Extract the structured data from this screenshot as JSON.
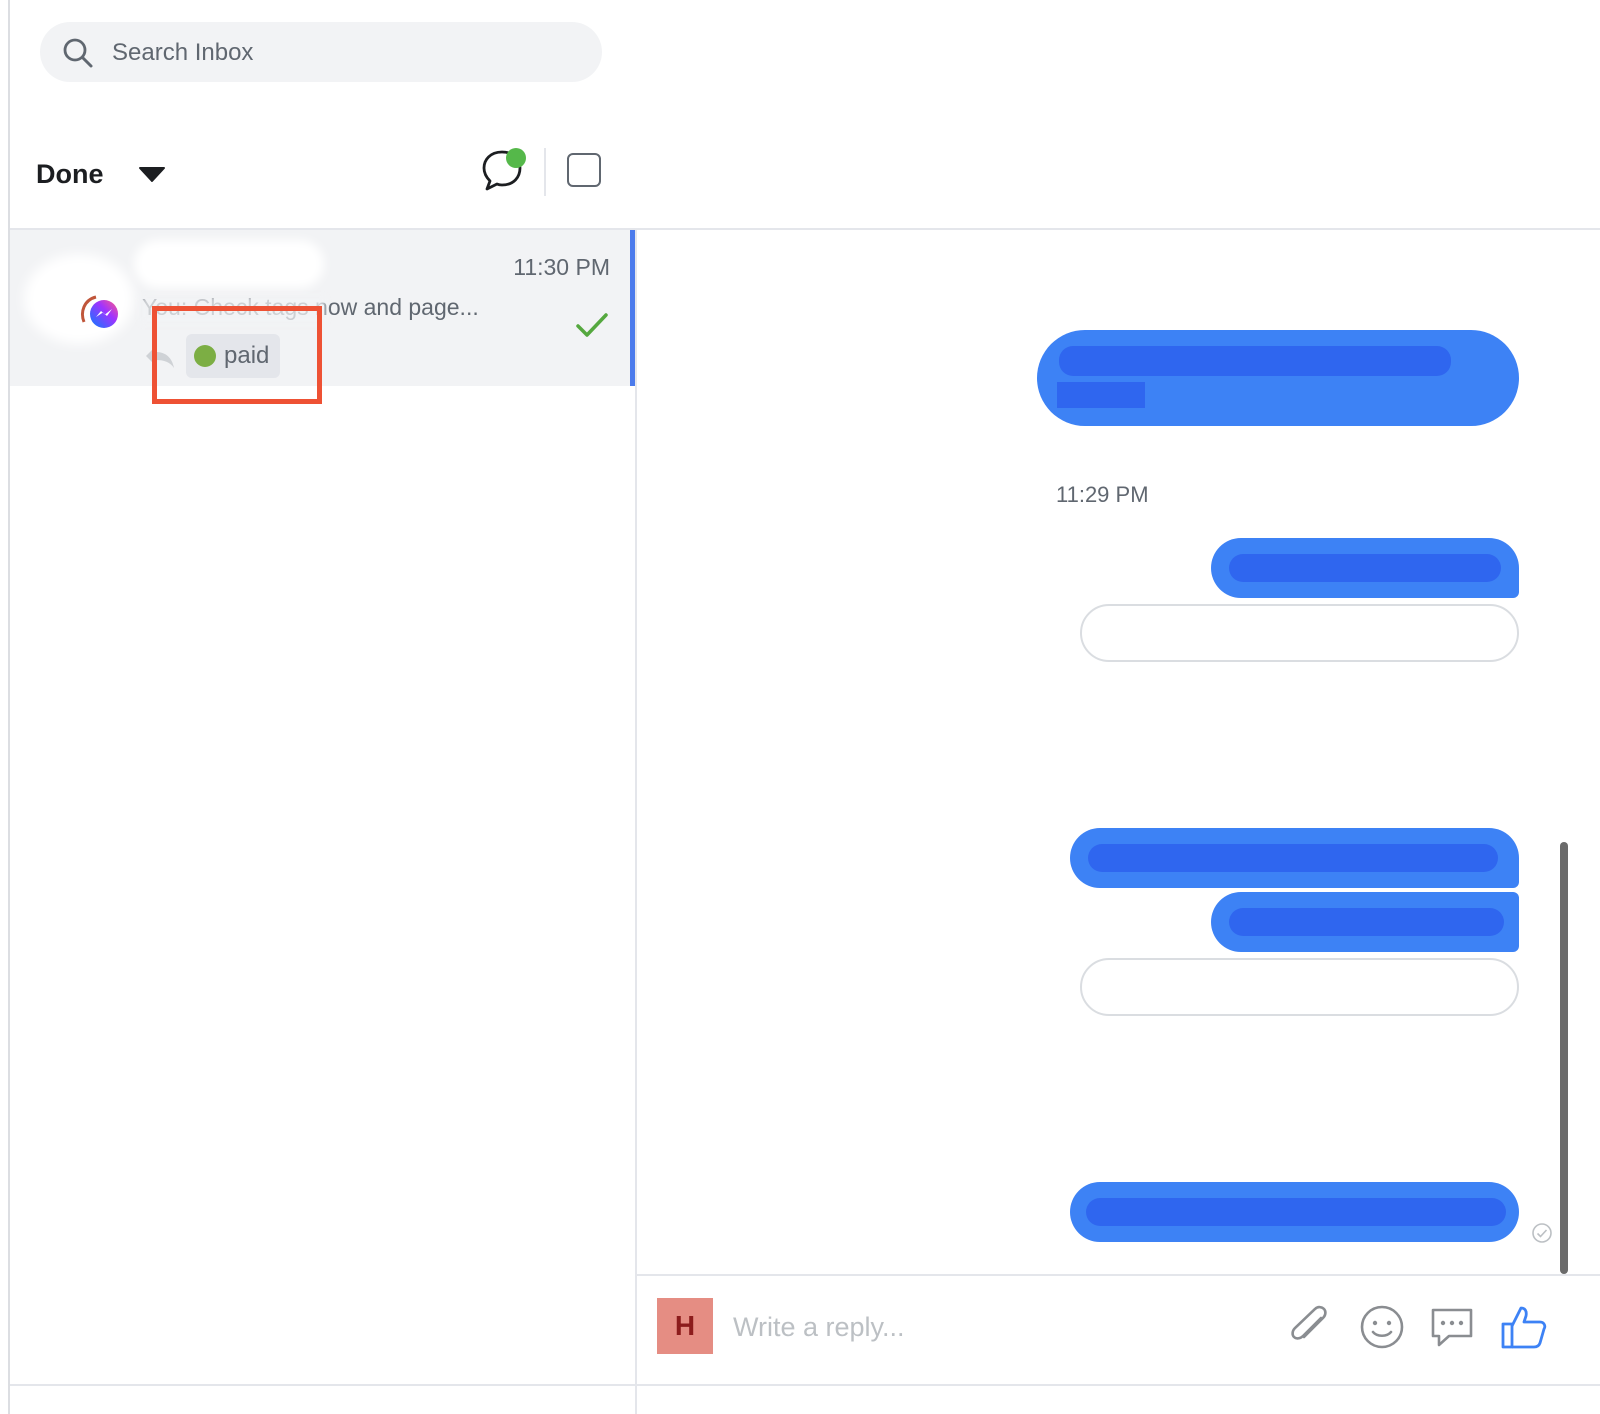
{
  "search": {
    "placeholder": "Search Inbox"
  },
  "toolbar": {
    "status_label": "Done"
  },
  "conversations": [
    {
      "time": "11:30 PM",
      "snippet": "You: Check tags now and page...",
      "tag": {
        "label": "paid",
        "color": "#7cae44"
      },
      "channel_icon": "messenger-icon",
      "status_icon": "done-check-icon"
    }
  ],
  "thread": {
    "timestamp": "11:29 PM"
  },
  "composer": {
    "agent_initial": "H",
    "reply_placeholder": "Write a reply..."
  },
  "colors": {
    "bubble": "#3d82f5",
    "accent": "#4b7bec",
    "highlight": "#ee5134",
    "done_check": "#55a83f",
    "avatar": "#e58d83"
  }
}
